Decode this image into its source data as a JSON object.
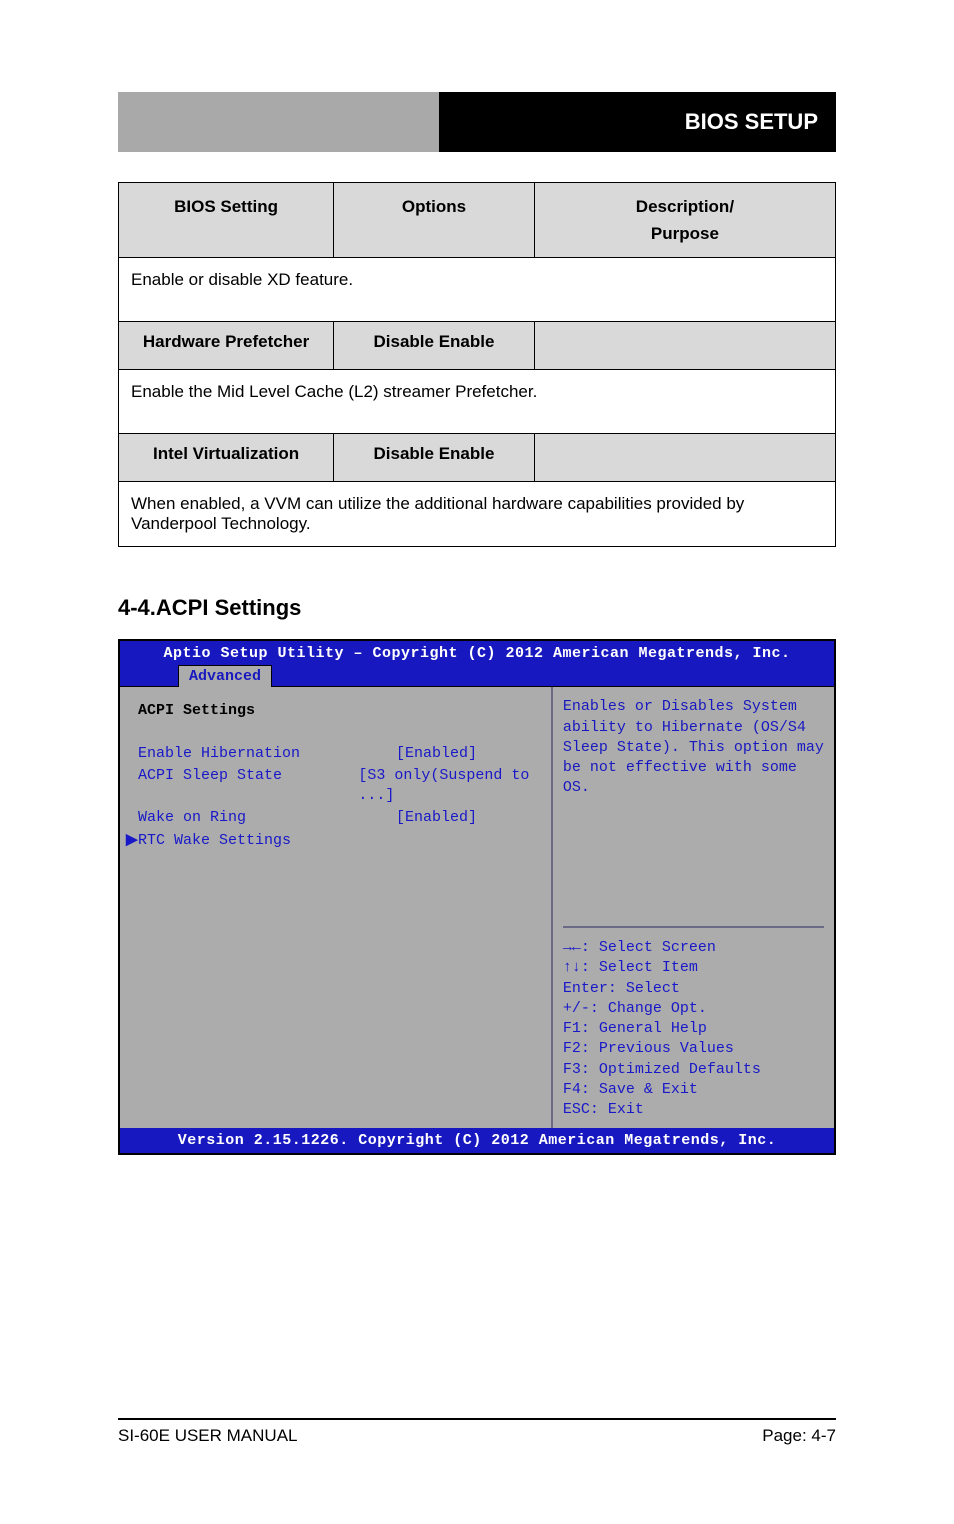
{
  "header": {
    "right_label": "BIOS SETUP"
  },
  "table": {
    "head": {
      "col1": "BIOS Setting",
      "col2": "Options",
      "col3_line1": "Description/",
      "col3_line2": "Purpose"
    },
    "row1_desc": "Enable or disable XD feature.",
    "row2": {
      "c1": "Hardware Prefetcher",
      "c2": "Disable\nEnable",
      "c3": ""
    },
    "row2_desc": "Enable the Mid Level Cache (L2) streamer Prefetcher.",
    "row3": {
      "c1": "Intel Virtualization",
      "c2": "Disable\nEnable",
      "c3": ""
    },
    "row3_desc": "When enabled, a VVM can utilize the additional hardware capabilities provided by Vanderpool Technology."
  },
  "section_title": "4-4.ACPI Settings",
  "bios": {
    "titlebar": "Aptio Setup Utility – Copyright (C) 2012 American Megatrends, Inc.",
    "tab": "Advanced",
    "heading": "ACPI Settings",
    "items": [
      {
        "k": "Enable Hibernation",
        "v": "[Enabled]"
      },
      {
        "k": "ACPI Sleep State",
        "v": "[S3 only(Suspend to ...]"
      },
      {
        "k": "Wake on Ring",
        "v": "[Enabled]"
      },
      {
        "k": "RTC Wake Settings",
        "v": ""
      }
    ],
    "arrow_char": "▶",
    "help": [
      "Enables or Disables System",
      "ability to Hibernate (OS/S4",
      "Sleep State). This option may",
      "be not effective with some OS."
    ],
    "hints": [
      "→←: Select Screen",
      "↑↓: Select Item",
      "Enter: Select",
      "+/-: Change Opt.",
      "F1: General Help",
      "F2: Previous Values",
      "F3: Optimized Defaults",
      "F4: Save & Exit",
      "ESC: Exit"
    ],
    "footer": "Version 2.15.1226. Copyright (C) 2012 American Megatrends, Inc."
  },
  "footer": {
    "left": "SI-60E USER MANUAL",
    "right": "Page: 4-7"
  }
}
